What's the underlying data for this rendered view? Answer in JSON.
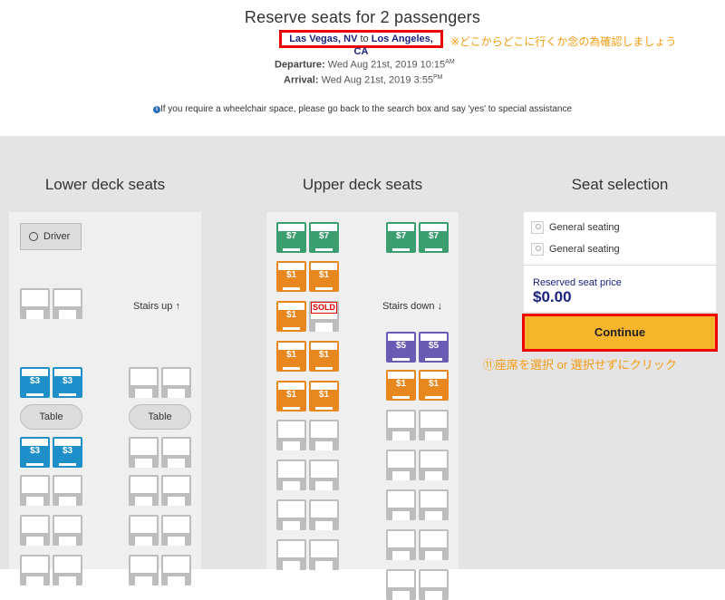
{
  "header": {
    "title": "Reserve seats for 2 passengers",
    "route_from": "Las Vegas, NV",
    "route_to_word": "to",
    "route_to": "Los Angeles, CA",
    "route_note": "※どこからどこに行くか念の為確認しましょう",
    "departure_label": "Departure:",
    "departure_value": "Wed Aug 21st, 2019 10:15",
    "departure_ampm": "AM",
    "arrival_label": "Arrival:",
    "arrival_value": "Wed Aug 21st, 2019 3:55",
    "arrival_ampm": "PM",
    "wheelchair_info": "If you require a wheelchair space, please go back to the search box and say 'yes' to special assistance"
  },
  "lower_deck": {
    "title": "Lower deck seats",
    "driver_label": "Driver",
    "stairs_label": "Stairs up",
    "table_label": "Table"
  },
  "upper_deck": {
    "title": "Upper deck seats",
    "stairs_label": "Stairs down",
    "sold_label": "SOLD"
  },
  "selection": {
    "title": "Seat selection",
    "passengers": [
      "General seating",
      "General seating"
    ],
    "price_label": "Reserved seat price",
    "price_value": "$0.00",
    "continue_label": "Continue",
    "note": "⑪座席を選択 or 選択せずにクリック"
  },
  "colors": {
    "green": "#3a9e6e",
    "orange": "#e8871e",
    "blue": "#1e8fc8",
    "purple": "#6a5bb5",
    "empty": "#bdbdbd"
  }
}
